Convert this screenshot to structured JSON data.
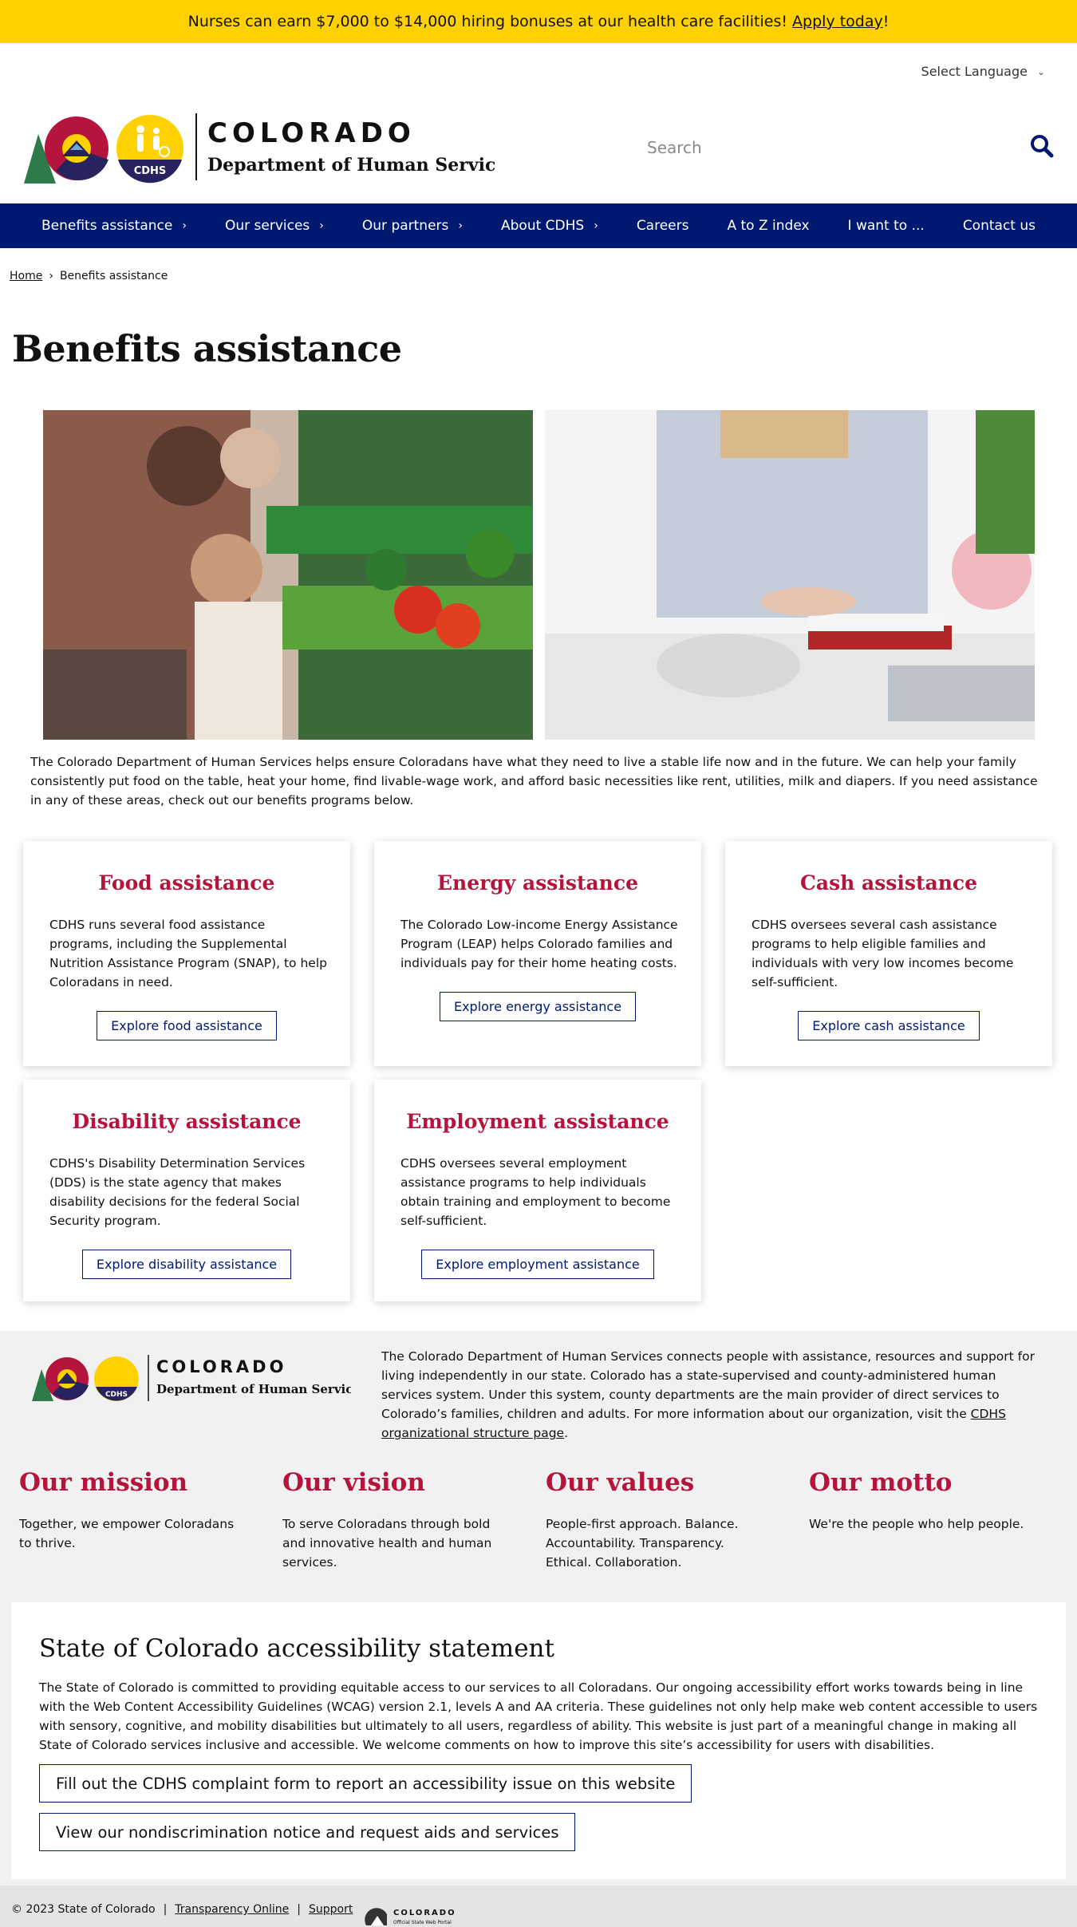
{
  "alert": {
    "text": "Nurses can earn $7,000 to $14,000 hiring bonuses at our health care facilities! ",
    "link": "Apply today",
    "trail": "!"
  },
  "header": {
    "language": "Select Language",
    "logo_word": "COLORADO",
    "logo_sub": "Department of Human Services",
    "logo_badge": "CDHS",
    "search_placeholder": "Search"
  },
  "nav": {
    "items": [
      {
        "label": "Benefits assistance",
        "has_submenu": true
      },
      {
        "label": "Our services",
        "has_submenu": true
      },
      {
        "label": "Our partners",
        "has_submenu": true
      },
      {
        "label": "About CDHS",
        "has_submenu": true
      },
      {
        "label": "Careers",
        "has_submenu": false
      },
      {
        "label": "A to Z index",
        "has_submenu": false
      },
      {
        "label": "I want to ...",
        "has_submenu": false
      },
      {
        "label": "Contact us",
        "has_submenu": false
      }
    ]
  },
  "breadcrumb": {
    "home": "Home",
    "sep": "›",
    "current": "Benefits assistance"
  },
  "page": {
    "title": "Benefits assistance",
    "intro": "The Colorado Department of Human Services helps ensure Coloradans have what they need to live a stable life now and in the future. We can help your family consistently put food on the table, heat your home, find livable-wage work, and afford basic necessities like rent, utilities, milk and diapers. If you need assistance in any of these areas, check out our benefits programs below."
  },
  "cards": [
    {
      "title": "Food assistance",
      "body": "CDHS runs several food assistance programs, including the Supplemental Nutrition Assistance Program (SNAP), to help Coloradans in need.",
      "button": "Explore food assistance"
    },
    {
      "title": "Energy assistance",
      "body": "The Colorado Low-income Energy Assistance Program (LEAP) helps Colorado families and individuals pay for their home heating costs.",
      "button": "Explore energy assistance"
    },
    {
      "title": "Cash assistance",
      "body": "CDHS oversees several cash assistance programs to help eligible families and individuals with very low incomes become self-sufficient.",
      "button": "Explore cash assistance"
    },
    {
      "title": "Disability assistance",
      "body": "CDHS's Disability Determination Services (DDS) is the state agency that makes disability decisions for the federal Social Security program.",
      "button": "Explore disability assistance"
    },
    {
      "title": "Employment assistance",
      "body": "CDHS oversees several employment assistance programs to help individuals obtain training and employment to become self-sufficient.",
      "button": "Explore employment assistance"
    }
  ],
  "footer": {
    "description": "The Colorado Department of Human Services connects people with assistance, resources and support for living independently in our state. Colorado has a state-supervised and county-administered human services system. Under this system, county departments are the main provider of direct services to Colorado’s families, children and adults. For more information about our organization, visit the ",
    "desc_link": "CDHS organizational structure page",
    "desc_end": ".",
    "mission": {
      "title": "Our mission",
      "text": "Together, we empower Coloradans to thrive."
    },
    "vision": {
      "title": "Our vision",
      "text": "To serve Coloradans through bold and innovative health and human services."
    },
    "values": {
      "title": "Our values",
      "text": "People-first approach. Balance. Accountability. Transparency. Ethical. Collaboration."
    },
    "motto": {
      "title": "Our motto",
      "text": "We're the people who help people."
    }
  },
  "accessibility": {
    "title": "State of Colorado accessibility statement",
    "body": "The State of Colorado is committed to providing equitable access to our services to all Coloradans. Our ongoing accessibility effort works towards being in line with the Web Content Accessibility Guidelines (WCAG) version 2.1, levels A and AA criteria. These guidelines not only help make web content accessible to users with sensory, cognitive, and mobility disabilities but ultimately to all users, regardless of ability. This website is just part of a meaningful change in making all State of Colorado services inclusive and accessible. We welcome comments on how to improve this site’s accessibility for users with disabilities.",
    "button1": "Fill out the CDHS complaint form to report an accessibility issue on this website",
    "button2": "View our nondiscrimination notice and request aids and services"
  },
  "bottom": {
    "copyright": "© 2023 State of Colorado",
    "sep": "|",
    "transparency": "Transparency Online",
    "support": "Support",
    "portal_word": "COLORADO",
    "portal_sub": "Official State Web Portal"
  },
  "colors": {
    "brand_navy": "#001970",
    "accent_red": "#b5153c",
    "alert_yellow": "#ffd100"
  }
}
